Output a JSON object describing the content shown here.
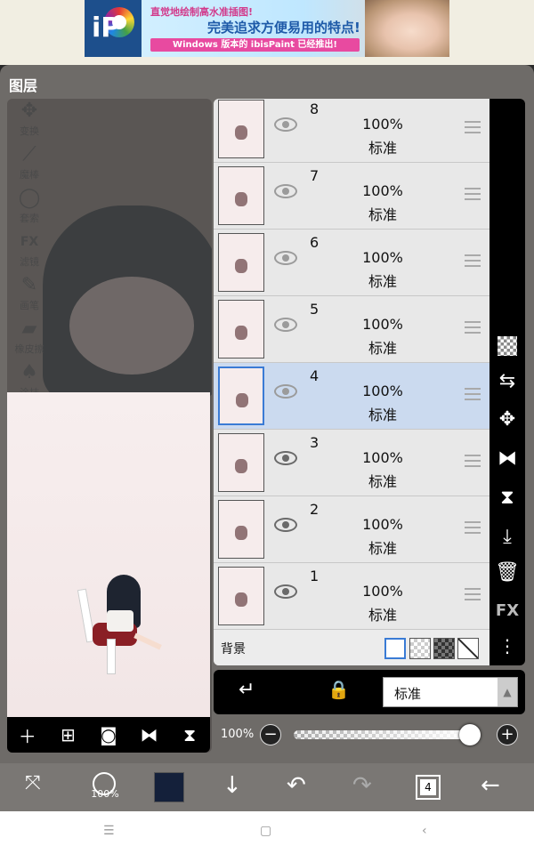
{
  "ad": {
    "logo_text": "iP",
    "line1": "直觉地绘制高水准插图!",
    "line2": "完美追求方便易用的特点!",
    "line3": "Windows 版本的 ibisPaint 已经推出!"
  },
  "panel": {
    "title": "图层"
  },
  "tools": [
    {
      "icon": "move-icon",
      "label": "变换"
    },
    {
      "icon": "magic-wand-icon",
      "label": "魔棒"
    },
    {
      "icon": "lasso-icon",
      "label": "套索"
    },
    {
      "icon": "fx-icon",
      "label": "滤镜"
    },
    {
      "icon": "brush-icon",
      "label": "画笔"
    },
    {
      "icon": "eraser-icon",
      "label": "橡皮擦"
    },
    {
      "icon": "fill-icon",
      "label": "涂抹"
    }
  ],
  "layers": [
    {
      "number": "8",
      "opacity": "100%",
      "blend": "标准",
      "visible": false,
      "selected": false
    },
    {
      "number": "7",
      "opacity": "100%",
      "blend": "标准",
      "visible": false,
      "selected": false
    },
    {
      "number": "6",
      "opacity": "100%",
      "blend": "标准",
      "visible": false,
      "selected": false
    },
    {
      "number": "5",
      "opacity": "100%",
      "blend": "标准",
      "visible": false,
      "selected": false
    },
    {
      "number": "4",
      "opacity": "100%",
      "blend": "标准",
      "visible": false,
      "selected": true
    },
    {
      "number": "3",
      "opacity": "100%",
      "blend": "标准",
      "visible": true,
      "selected": false
    },
    {
      "number": "2",
      "opacity": "100%",
      "blend": "标准",
      "visible": true,
      "selected": false
    },
    {
      "number": "1",
      "opacity": "100%",
      "blend": "标准",
      "visible": true,
      "selected": false
    }
  ],
  "background": {
    "label": "背景",
    "selected": "white"
  },
  "blend_bar": {
    "mode": "标准"
  },
  "opacity": {
    "label": "100%",
    "value": 1.0
  },
  "right_toolbar": [
    "transparent-layer-icon",
    "swap-layer-icon",
    "move-icon",
    "flip-horizontal-icon",
    "flip-vertical-icon",
    "merge-down-icon",
    "trash-icon",
    "fx-icon",
    "more-icon"
  ],
  "right_toolbar_fx_label": "FX",
  "preview_toolbar": [
    "add-layer-icon",
    "add-special-layer-icon",
    "camera-icon",
    "flip-horizontal-icon",
    "flip-vertical-icon"
  ],
  "bottom_toolbar": {
    "brush_size": "100%",
    "layer_count": "4",
    "primary_color": "#14203a"
  },
  "colors": {
    "selection": "#cbdaef",
    "accent": "#3a7bd5"
  }
}
